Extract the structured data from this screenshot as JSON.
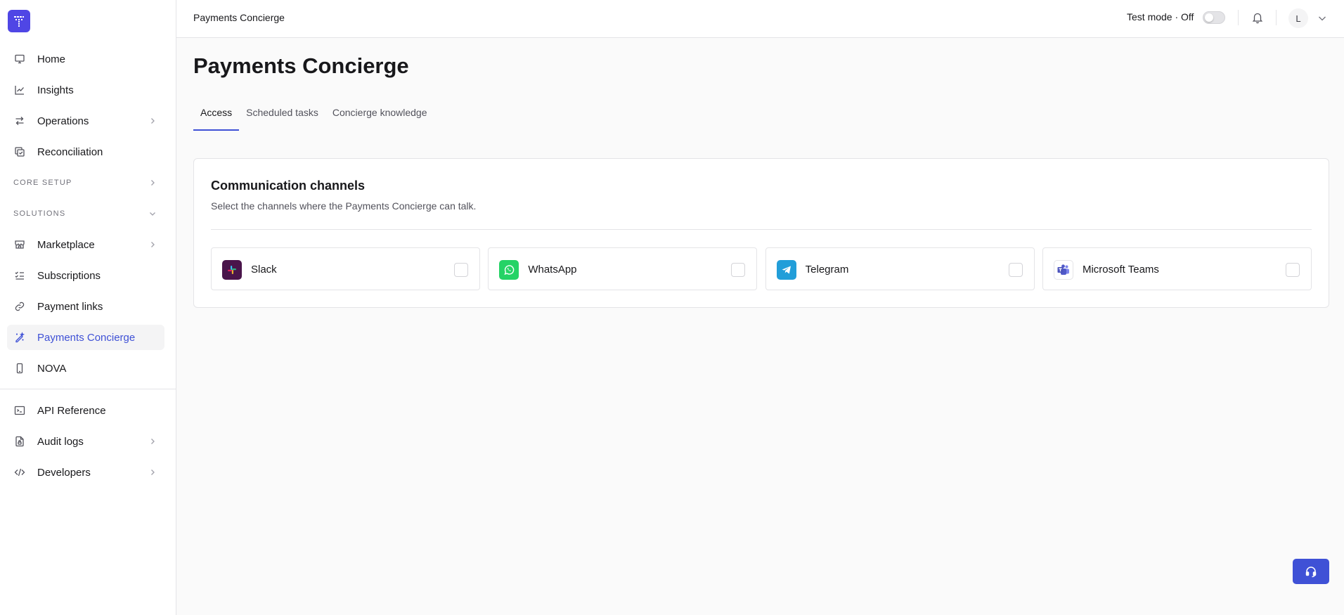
{
  "sidebar": {
    "items": [
      {
        "label": "Home",
        "icon": "monitor-icon"
      },
      {
        "label": "Insights",
        "icon": "chart-line-icon"
      },
      {
        "label": "Operations",
        "icon": "arrows-swap-icon"
      },
      {
        "label": "Reconciliation",
        "icon": "copy-check-icon"
      }
    ],
    "core_setup_label": "CORE SETUP",
    "solutions_label": "SOLUTIONS",
    "solution_items": [
      {
        "label": "Marketplace",
        "icon": "storefront-icon"
      },
      {
        "label": "Subscriptions",
        "icon": "list-checks-icon"
      },
      {
        "label": "Payment links",
        "icon": "link-icon"
      },
      {
        "label": "Payments Concierge",
        "icon": "sparkles-pen-icon"
      },
      {
        "label": "NOVA",
        "icon": "phone-device-icon"
      }
    ],
    "bottom_items": [
      {
        "label": "API Reference",
        "icon": "terminal-icon"
      },
      {
        "label": "Audit logs",
        "icon": "file-lock-icon"
      },
      {
        "label": "Developers",
        "icon": "code-icon"
      }
    ]
  },
  "topbar": {
    "breadcrumb": "Payments Concierge",
    "test_mode_label": "Test mode · Off",
    "avatar_initial": "L"
  },
  "page": {
    "title": "Payments Concierge",
    "tabs": [
      {
        "label": "Access"
      },
      {
        "label": "Scheduled tasks"
      },
      {
        "label": "Concierge knowledge"
      }
    ]
  },
  "card": {
    "title": "Communication channels",
    "subtitle": "Select the channels where the Payments Concierge can talk.",
    "channels": [
      {
        "name": "Slack",
        "icon": "slack-icon",
        "color": "#4a154b"
      },
      {
        "name": "WhatsApp",
        "icon": "whatsapp-icon",
        "color": "#25d366"
      },
      {
        "name": "Telegram",
        "icon": "telegram-icon",
        "color": "#229ed9"
      },
      {
        "name": "Microsoft Teams",
        "icon": "microsoft-teams-icon",
        "color": "#5059c9"
      }
    ]
  },
  "colors": {
    "accent": "#3f51d6",
    "brand": "#4f46e5"
  }
}
